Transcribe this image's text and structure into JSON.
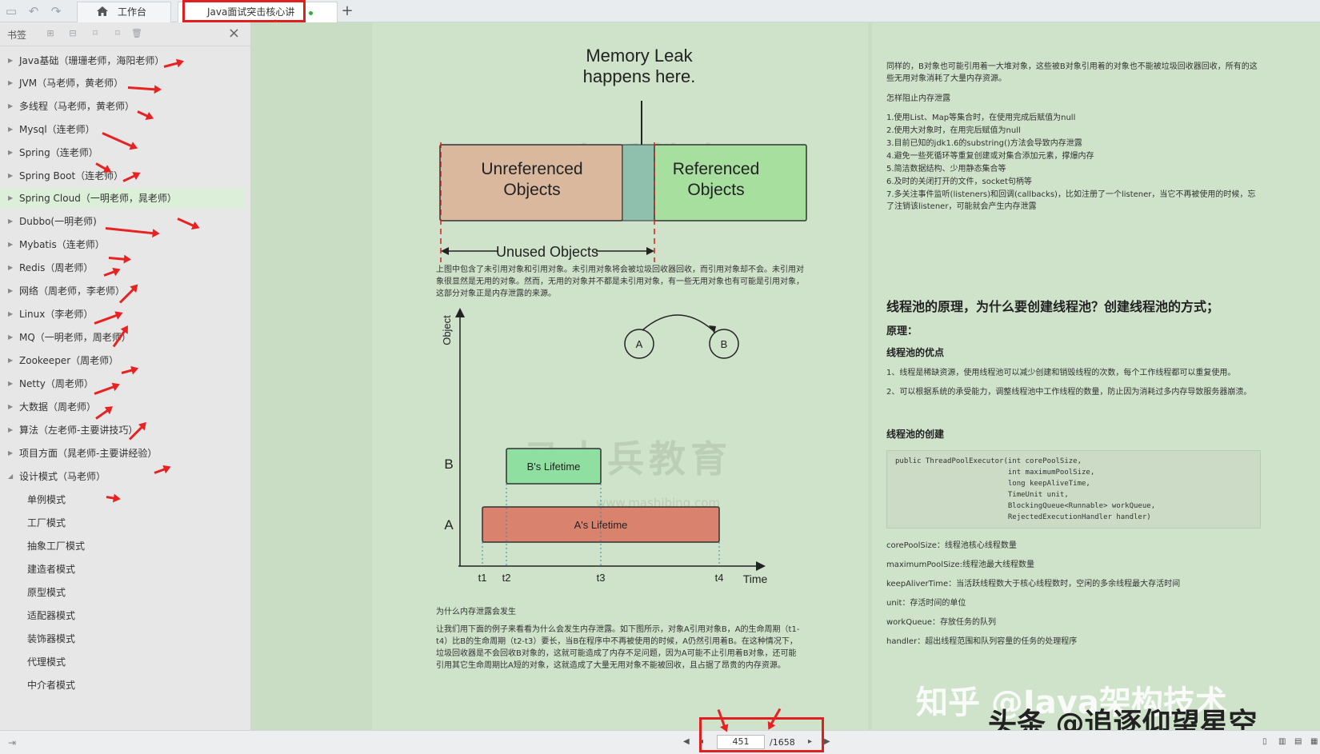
{
  "topbar": {
    "home_tab": "工作台",
    "active_tab": "Java面试突击核心讲",
    "add_tab": "+"
  },
  "sidebar": {
    "title": "书签",
    "close": "×",
    "items": [
      {
        "label": "Java基础（珊珊老师，海阳老师）"
      },
      {
        "label": "JVM（马老师，黄老师）"
      },
      {
        "label": "多线程（马老师，黄老师）"
      },
      {
        "label": "Mysql（连老师）"
      },
      {
        "label": "Spring（连老师）"
      },
      {
        "label": "Spring Boot（连老师）"
      },
      {
        "label": "Spring Cloud（一明老师，晁老师）"
      },
      {
        "label": "Dubbo(一明老师)"
      },
      {
        "label": "Mybatis（连老师）"
      },
      {
        "label": "Redis（周老师）"
      },
      {
        "label": "网络（周老师，李老师）"
      },
      {
        "label": "Linux（李老师）"
      },
      {
        "label": "MQ（一明老师，周老师）"
      },
      {
        "label": "Zookeeper（周老师）"
      },
      {
        "label": "Netty（周老师）"
      },
      {
        "label": "大数据（周老师）"
      },
      {
        "label": "算法（左老师-主要讲技巧）"
      },
      {
        "label": "项目方面（晁老师-主要讲经验）"
      },
      {
        "label": "设计模式（马老师）"
      }
    ],
    "children": [
      {
        "label": "单例模式"
      },
      {
        "label": "工厂模式"
      },
      {
        "label": "抽象工厂模式"
      },
      {
        "label": "建造者模式"
      },
      {
        "label": "原型模式"
      },
      {
        "label": "适配器模式"
      },
      {
        "label": "装饰器模式"
      },
      {
        "label": "代理模式"
      },
      {
        "label": "中介者模式"
      }
    ]
  },
  "left_page": {
    "leak_title_1": "Memory Leak",
    "leak_title_2": "happens here.",
    "unref_1": "Unreferenced",
    "unref_2": "Objects",
    "ref_1": "Referenced",
    "ref_2": "Objects",
    "unused": "Unused Objects",
    "para1": "上图中包含了未引用对象和引用对象。未引用对象将会被垃圾回收器回收，而引用对象却不会。未引用对象很显然是无用的对象。然而，无用的对象并不都是未引用对象，有一些无用对象也有可能是引用对象，这部分对象正是内存泄露的来源。",
    "axis_object": "Object",
    "node_a": "A",
    "node_b": "B",
    "row_b": "B",
    "row_a": "A",
    "b_life": "B's Lifetime",
    "a_life": "A's Lifetime",
    "t1": "t1",
    "t2": "t2",
    "t3": "t3",
    "t4": "t4",
    "time": "Time",
    "why_title": "为什么内存泄露会发生",
    "para2": "让我们用下面的例子来看看为什么会发生内存泄露。如下图所示，对象A引用对象B，A的生命周期（t1-t4）比B的生命周期（t2-t3）要长，当B在程序中不再被使用的时候，A仍然引用着B。在这种情况下，垃圾回收器是不会回收B对象的，这就可能造成了内存不足问题，因为A可能不止引用着B对象，还可能引用其它生命周期比A短的对象，这就造成了大量无用对象不能被回收，且占据了昂贵的内存资源。",
    "wm": "马士兵教育",
    "wm_url": "www.mashibing.com"
  },
  "right_page": {
    "p1": "同样的，B对象也可能引用着一大堆对象，这些被B对象引用着的对象也不能被垃圾回收器回收，所有的这些无用对象消耗了大量内存资源。",
    "how_title": "怎样阻止内存泄露",
    "tips": [
      "1.使用List、Map等集合时，在使用完成后赋值为null",
      "2.使用大对象时，在用完后赋值为null",
      "3.目前已知的jdk1.6的substring()方法会导致内存泄露",
      "4.避免一些死循环等重复创建或对集合添加元素，撑爆内存",
      "5.简洁数据结构、少用静态集合等",
      "6.及时的关闭打开的文件，socket句柄等",
      "7.多关注事件监听(listeners)和回调(callbacks)，比如注册了一个listener，当它不再被使用的时候，忘了注销该listener，可能就会产生内存泄露"
    ],
    "h_pool": "线程池的原理，为什么要创建线程池？创建线程池的方式；",
    "h_principle": "原理：",
    "h_adv": "线程池的优点",
    "adv1": "1、线程是稀缺资源，使用线程池可以减少创建和销毁线程的次数，每个工作线程都可以重复使用。",
    "adv2": "2、可以根据系统的承受能力，调整线程池中工作线程的数量，防止因为消耗过多内存导致服务器崩溃。",
    "h_create": "线程池的创建",
    "code": "public ThreadPoolExecutor(int corePoolSize,\n                          int maximumPoolSize,\n                          long keepAliveTime,\n                          TimeUnit unit,\n                          BlockingQueue<Runnable> workQueue,\n                          RejectedExecutionHandler handler)",
    "params": [
      "corePoolSize：线程池核心线程数量",
      "maximumPoolSize:线程池最大线程数量",
      "keepAliverTime：当活跃线程数大于核心线程数时，空闲的多余线程最大存活时间",
      "unit：存活时间的单位",
      "workQueue：存放任务的队列",
      "handler：超出线程范围和队列容量的任务的处理程序"
    ]
  },
  "overlay": {
    "zhihu": "知乎 @Java架构技术",
    "toutiao": "头条 @追逐仰望星空"
  },
  "bottombar": {
    "page": "451",
    "total": "/1658"
  }
}
